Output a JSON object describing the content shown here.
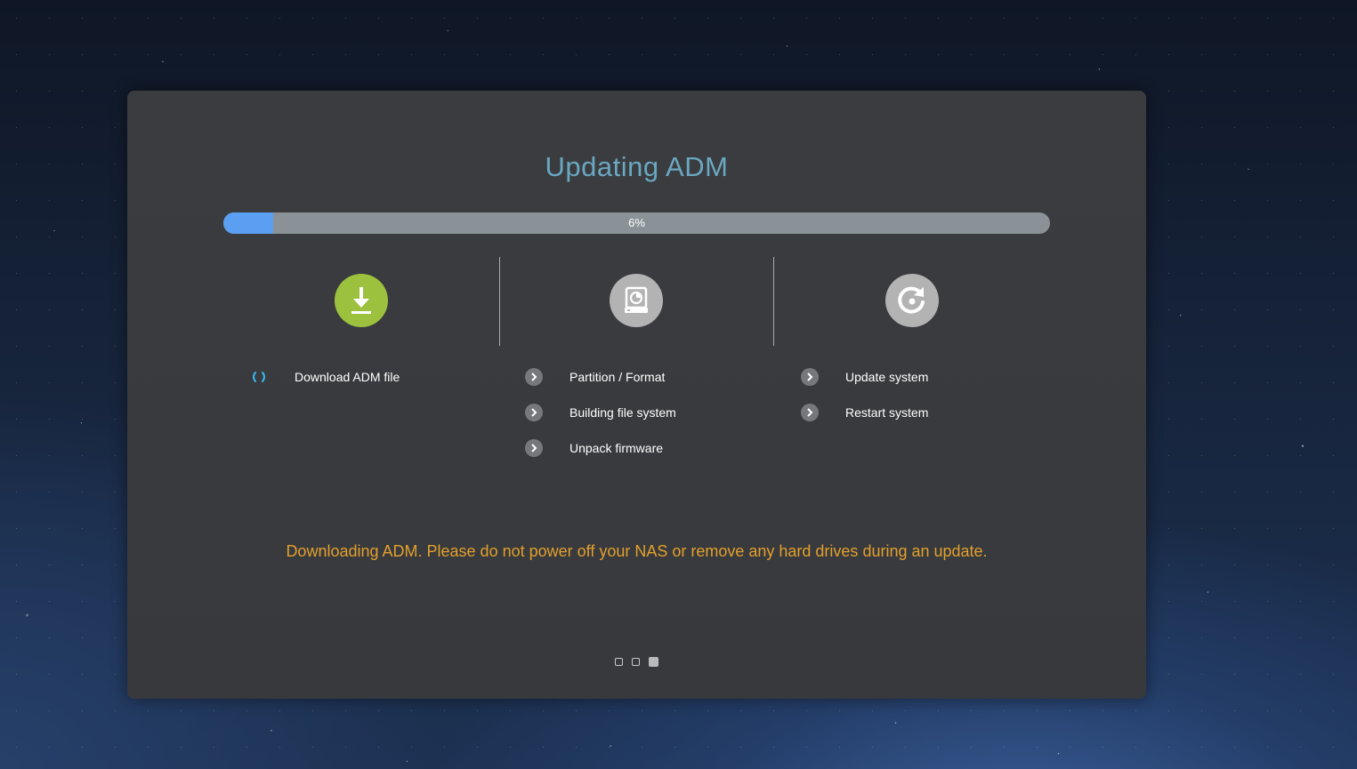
{
  "dialog": {
    "title": "Updating ADM",
    "progress": {
      "percent": 6,
      "label": "6%"
    },
    "steps": [
      {
        "icon": "download-icon",
        "state": "active",
        "tasks": [
          {
            "label": "Download ADM file",
            "state": "in-progress",
            "marker": "( )"
          }
        ]
      },
      {
        "icon": "disk-partition-icon",
        "state": "pending",
        "tasks": [
          {
            "label": "Partition / Format",
            "state": "pending"
          },
          {
            "label": "Building file system",
            "state": "pending"
          },
          {
            "label": "Unpack firmware",
            "state": "pending"
          }
        ]
      },
      {
        "icon": "restart-icon",
        "state": "pending",
        "tasks": [
          {
            "label": "Update system",
            "state": "pending"
          },
          {
            "label": "Restart system",
            "state": "pending"
          }
        ]
      }
    ],
    "warning": "Downloading ADM. Please do not power off your NAS or remove any hard drives during an update.",
    "pager": {
      "count": 3,
      "current": 3
    }
  },
  "colors": {
    "title": "#6aa7c2",
    "progress_fill": "#5b9ff2",
    "progress_track": "#8a9297",
    "active_step": "#9cc13f",
    "pending_step": "#b3b3b3",
    "warning": "#e3a02c",
    "loading_marker": "#39b8f0"
  }
}
